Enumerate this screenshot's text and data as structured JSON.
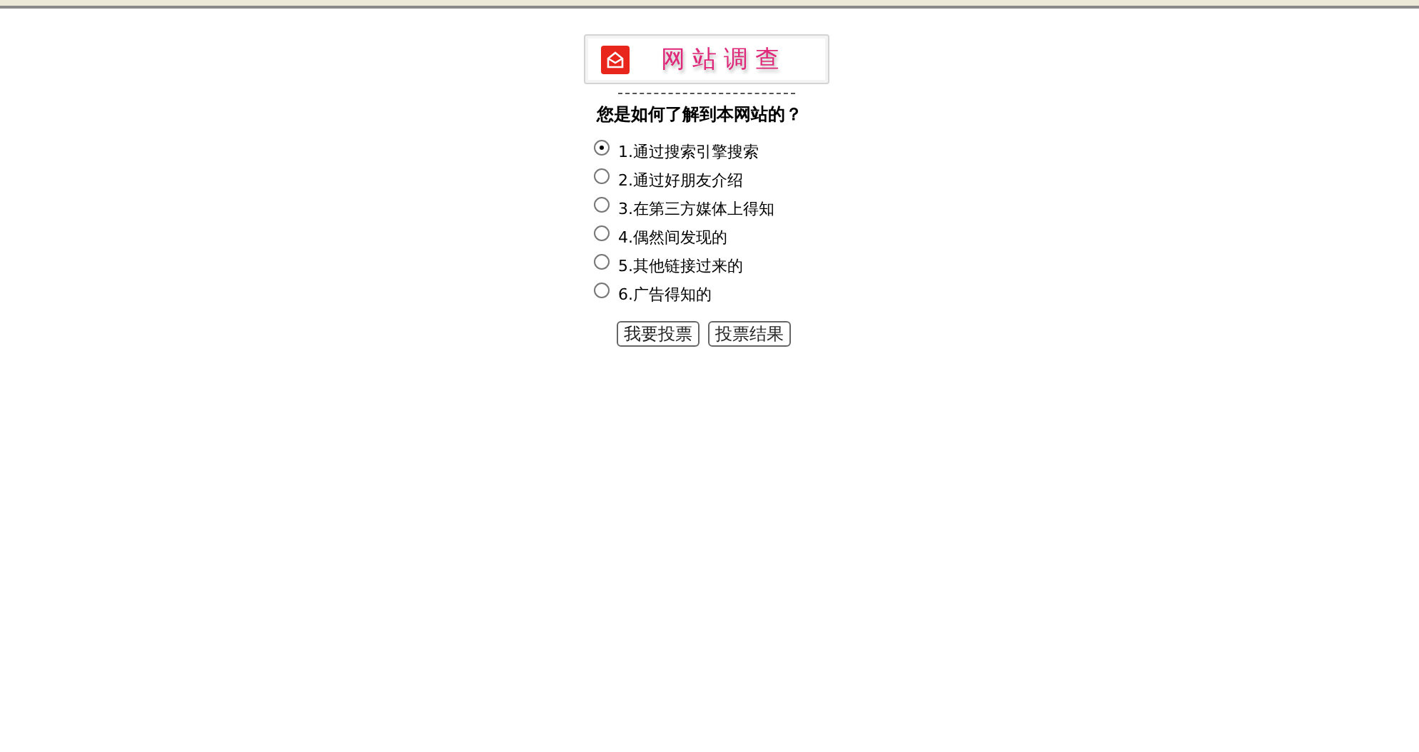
{
  "survey": {
    "title": "网站调查",
    "question": "您是如何了解到本网站的？",
    "options": [
      {
        "label": "1.通过搜索引擎搜索",
        "selected": true
      },
      {
        "label": "2.通过好朋友介绍",
        "selected": false
      },
      {
        "label": "3.在第三方媒体上得知",
        "selected": false
      },
      {
        "label": "4.偶然间发现的",
        "selected": false
      },
      {
        "label": "5.其他链接过来的",
        "selected": false
      },
      {
        "label": "6.广告得知的",
        "selected": false
      }
    ],
    "buttons": [
      "我要投票",
      "投票结果"
    ]
  }
}
